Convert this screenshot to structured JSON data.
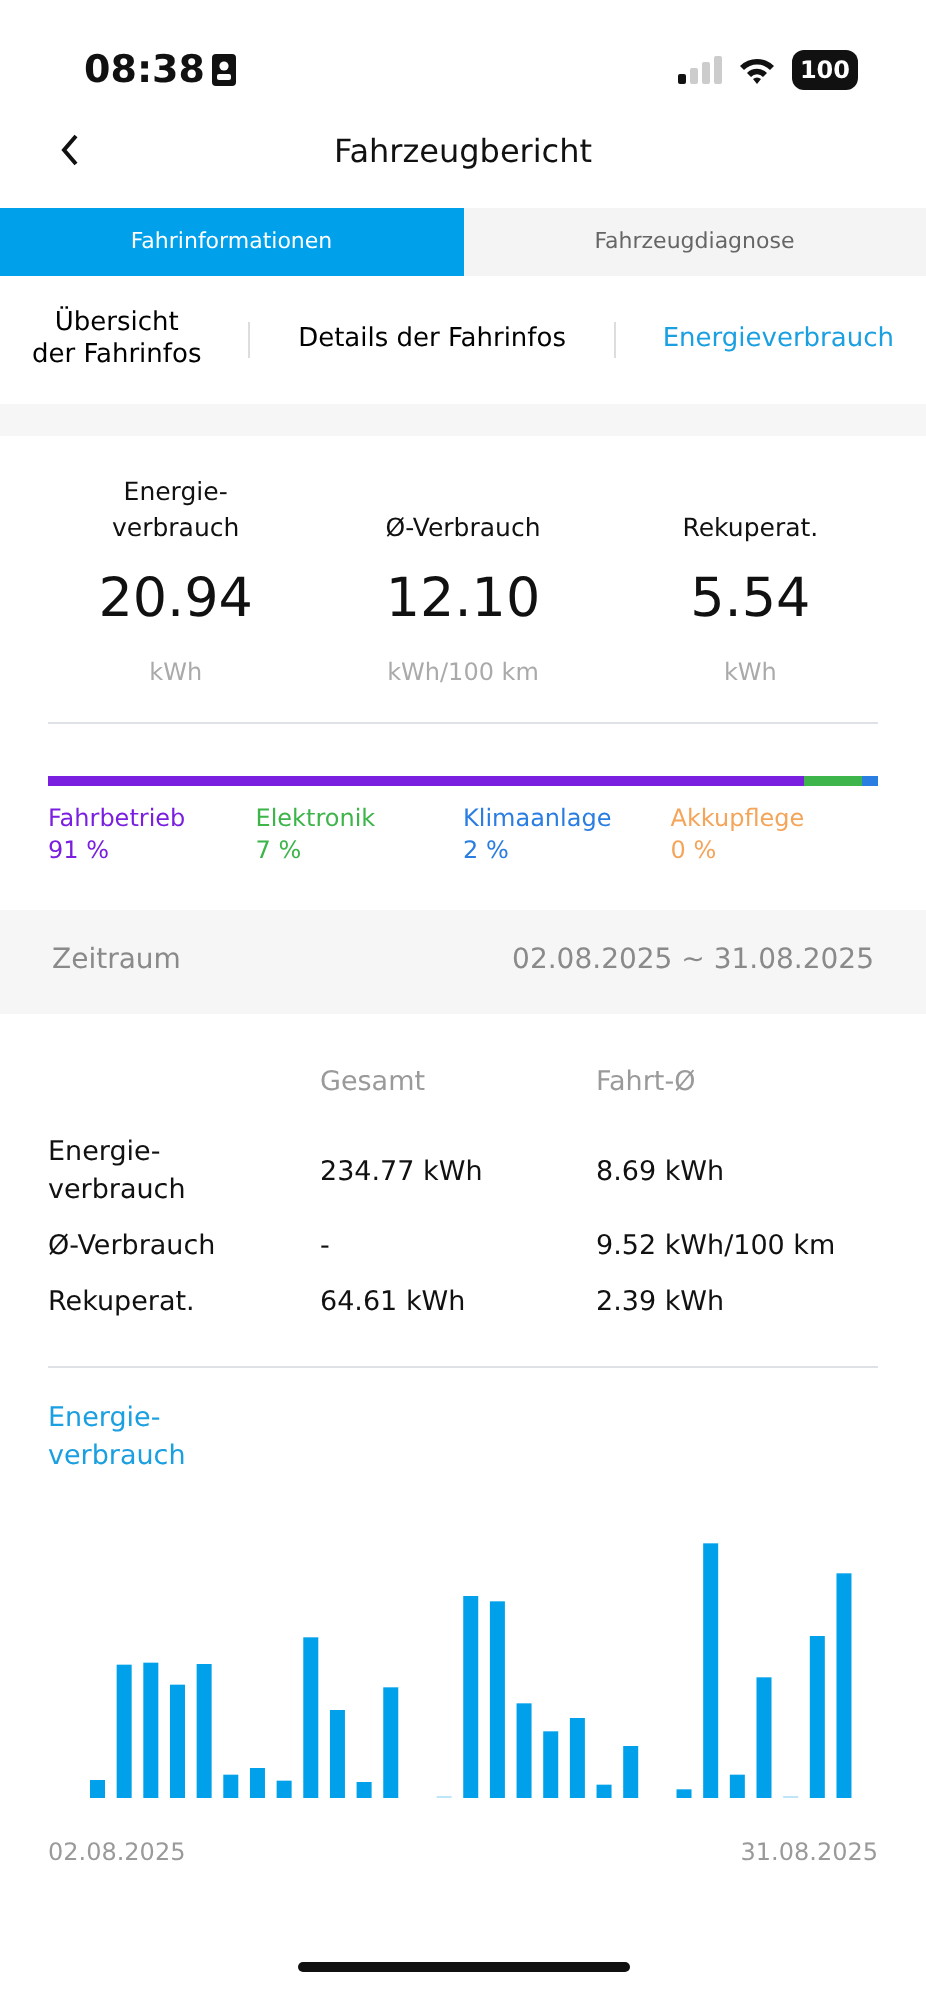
{
  "status_bar": {
    "time": "08:38",
    "battery": "100"
  },
  "header": {
    "title": "Fahrzeugbericht"
  },
  "tabs": [
    {
      "label": "Fahrinformationen",
      "selected": true
    },
    {
      "label": "Fahrzeugdiagnose",
      "selected": false
    }
  ],
  "subtabs": [
    {
      "label": "Übersicht\nder Fahrinfos",
      "selected": false
    },
    {
      "label": "Details der Fahrinfos",
      "selected": false
    },
    {
      "label": "Energieverbrauch",
      "selected": true
    }
  ],
  "summary": [
    {
      "label": "Energie-\nverbrauch",
      "value": "20.94",
      "unit": "kWh"
    },
    {
      "label": "Ø-Verbrauch",
      "value": "12.10",
      "unit": "kWh/100 km"
    },
    {
      "label": "Rekuperat.",
      "value": "5.54",
      "unit": "kWh"
    }
  ],
  "breakdown": [
    {
      "label": "Fahrbetrieb",
      "percent": "91 %",
      "color": "#7a1fe0"
    },
    {
      "label": "Elektronik",
      "percent": "7 %",
      "color": "#3db54a"
    },
    {
      "label": "Klimaanlage",
      "percent": "2 %",
      "color": "#2a7de1"
    },
    {
      "label": "Akkupflege",
      "percent": "0 %",
      "color": "#f4a55a"
    }
  ],
  "period": {
    "label": "Zeitraum",
    "range": "02.08.2025 ~ 31.08.2025"
  },
  "table": {
    "columns": [
      "Gesamt",
      "Fahrt-Ø"
    ],
    "rows": [
      {
        "label": "Energie-\nverbrauch",
        "total": "234.77 kWh",
        "average": "8.69 kWh"
      },
      {
        "label": "Ø-Verbrauch",
        "total": "-",
        "average": "9.52 kWh/100 km"
      },
      {
        "label": "Rekuperat.",
        "total": "64.61 kWh",
        "average": "2.39 kWh"
      }
    ]
  },
  "chart": {
    "title": "Energie-\nverbrauch",
    "start_label": "02.08.2025",
    "end_label": "31.08.2025"
  }
}
